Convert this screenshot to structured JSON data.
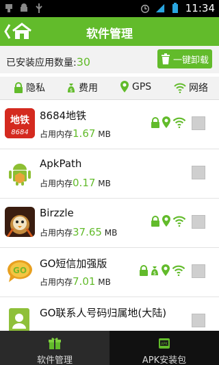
{
  "status_bar": {
    "time": "11:34",
    "icons": [
      "usb-icon",
      "android-icon",
      "usb-debug-icon",
      "alarm-icon",
      "signal-icon",
      "battery-icon"
    ]
  },
  "header": {
    "title": "软件管理",
    "back_icon": "back-home-icon"
  },
  "summary": {
    "label": "已安装应用数量:",
    "count": "30",
    "uninstall_label": "一键卸载"
  },
  "filters": [
    {
      "label": "隐私",
      "icon": "lock-icon"
    },
    {
      "label": "费用",
      "icon": "money-bag-icon"
    },
    {
      "label": "GPS",
      "icon": "location-pin-icon"
    },
    {
      "label": "网络",
      "icon": "wifi-icon"
    }
  ],
  "apps": [
    {
      "name": "8684地铁",
      "mem_label": "占用内存",
      "mem_value": "1.67",
      "mem_unit": "MB",
      "perms": [
        "lock",
        "gps",
        "wifi"
      ]
    },
    {
      "name": "ApkPath",
      "mem_label": "占用内存",
      "mem_value": "0.17",
      "mem_unit": "MB",
      "perms": []
    },
    {
      "name": "Birzzle",
      "mem_label": "占用内存",
      "mem_value": "37.65",
      "mem_unit": "MB",
      "perms": [
        "lock",
        "gps",
        "wifi"
      ]
    },
    {
      "name": "GO短信加强版",
      "mem_label": "占用内存",
      "mem_value": "7.01",
      "mem_unit": "MB",
      "perms": [
        "lock",
        "money",
        "gps",
        "wifi"
      ]
    },
    {
      "name": "GO联系人号码归属地(大陆)",
      "mem_label": "",
      "mem_value": "",
      "mem_unit": "",
      "perms": []
    }
  ],
  "app_icon_text": {
    "metro_top": "地铁",
    "metro_bottom": "8684"
  },
  "bottom_tabs": [
    {
      "label": "软件管理",
      "icon": "gift-box-icon",
      "active": true
    },
    {
      "label": "APK安装包",
      "icon": "apk-package-icon",
      "active": false
    }
  ],
  "colors": {
    "accent": "#62bb2b",
    "status_bar": "#000000",
    "bottom_bar": "#111111"
  }
}
